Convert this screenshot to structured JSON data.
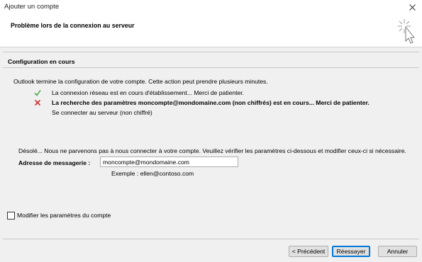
{
  "window": {
    "title": "Ajouter un compte"
  },
  "header": {
    "heading": "Problème lors de la connexion au serveur"
  },
  "section": {
    "title": "Configuration en cours"
  },
  "intro": "Outlook termine la configuration de votre compte. Cette action peut prendre plusieurs minutes.",
  "steps": [
    {
      "status": "success",
      "icon": "checkmark-icon",
      "color": "#3aa53a",
      "text": "La connexion réseau est en cours d'établissement... Merci de patienter."
    },
    {
      "status": "error",
      "icon": "x-mark-icon",
      "color": "#d32f2f",
      "text": "La recherche des paramètres moncompte@mondomaine.com (non chiffrés) est en cours... Merci de patienter."
    }
  ],
  "substep": "Se connecter au serveur (non chiffré)",
  "error_message": "Désolé... Nous ne parvenons pas à nous connecter à votre compte. Veuillez vérifier les paramètres ci-dessous et modifier ceux-ci si nécessaire.",
  "email": {
    "label": "Adresse de messagerie :",
    "value": "moncompte@mondomaine.com",
    "example": "Exemple : ellen@contoso.com"
  },
  "modify": {
    "label": "Modifier les paramètres du compte",
    "checked": false
  },
  "buttons": {
    "back": "< Précédent",
    "retry": "Réessayer",
    "cancel": "Annuler"
  }
}
